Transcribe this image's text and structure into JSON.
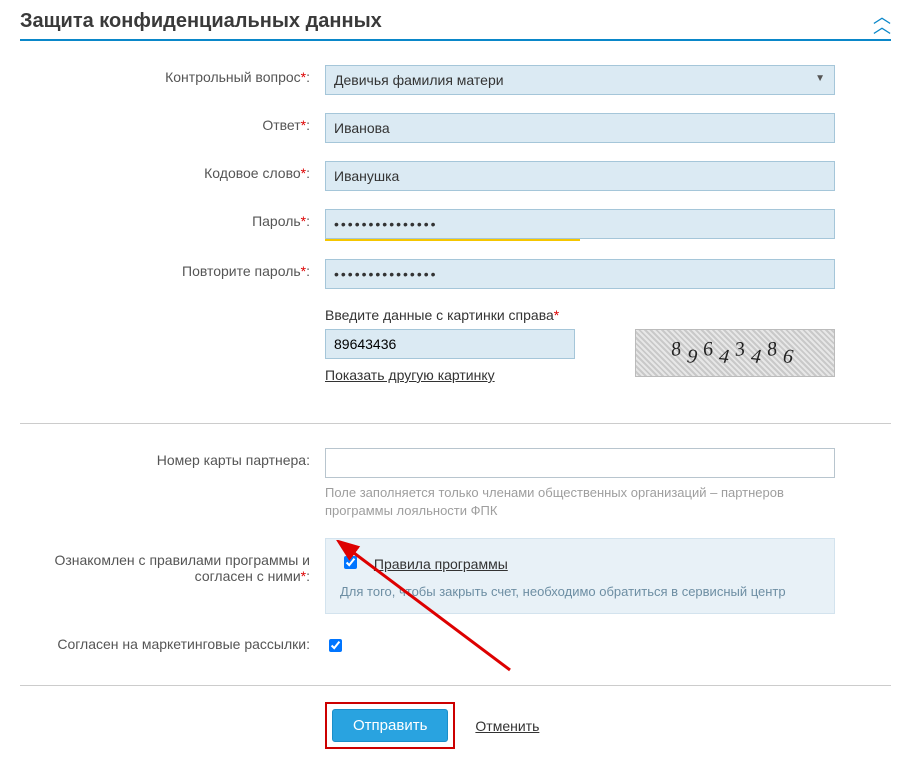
{
  "section": {
    "title": "Защита конфиденциальных данных"
  },
  "fields": {
    "question": {
      "label": "Контрольный вопрос",
      "value": "Девичья фамилия матери"
    },
    "answer": {
      "label": "Ответ",
      "value": "Иванова"
    },
    "codeword": {
      "label": "Кодовое слово",
      "value": "Иванушка"
    },
    "password": {
      "label": "Пароль",
      "value": "•••••••••••••••"
    },
    "password2": {
      "label": "Повторите пароль",
      "value": "•••••••••••••••"
    },
    "captcha": {
      "label": "Введите данные с картинки справа",
      "value": "89643436",
      "refresh": "Показать другую картинку",
      "digits": "89643486"
    },
    "partner": {
      "label": "Номер карты партнера",
      "hint": "Поле заполняется только членами общественных организаций – партнеров программы лояльности ФПК",
      "value": ""
    },
    "rules": {
      "label": "Ознакомлен с правилами программы и согласен с ними",
      "link": "Правила программы",
      "note": "Для того, чтобы закрыть счет, необходимо обратиться в сервисный центр"
    },
    "marketing": {
      "label": "Согласен на маркетинговые рассылки"
    }
  },
  "actions": {
    "submit": "Отправить",
    "cancel": "Отменить"
  }
}
